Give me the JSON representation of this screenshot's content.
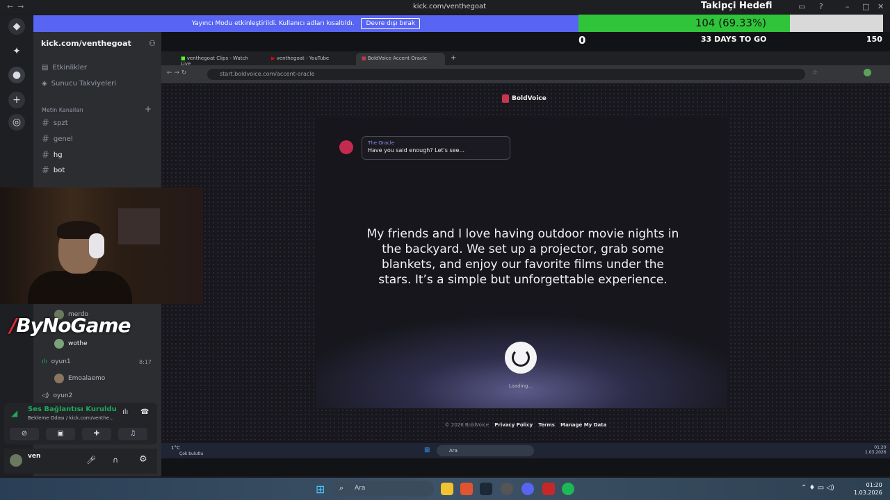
{
  "titlebar": {
    "url": "kick.com/venthegoat"
  },
  "banner": {
    "message": "Yayıncı Modu etkinleştirildi. Kullanıcı adları kısaltıldı.",
    "button": "Devre dışı bırak"
  },
  "goal": {
    "title": "Takipçi Hedefi",
    "progress_text": "104 (69.33%)",
    "progress": 0.6933,
    "min": "0",
    "days_left": "33 DAYS TO GO",
    "max": "150",
    "fill_color": "#2fc43a"
  },
  "sidebar": {
    "server_name": "kick.com/venthegoat",
    "items": [
      "Etkinlikler",
      "Sunucu Takviyeleri"
    ],
    "category": "Metin Kanalları",
    "channels": [
      "spzt",
      "genel",
      "hg",
      "bot"
    ]
  },
  "voice": {
    "users": [
      "merdo",
      "wothe"
    ],
    "channel1": "oyun1",
    "channel1_time": "8:17",
    "channel1_user": "Emoalaemo",
    "channel2": "oyun2",
    "status": "Ses Bağlantısı Kuruldu",
    "status_sub": "Bekleme Odası / kick.com/venthe...",
    "username": "ven"
  },
  "overlay": {
    "brand": "ByNoGame"
  },
  "browser": {
    "tabs": [
      "venthegoat Clips - Watch Live",
      "venthegoat - YouTube",
      "BoldVoice Accent Oracle"
    ],
    "url": "start.boldvoice.com/accent-oracle"
  },
  "boldvoice": {
    "logo": "BoldVoice",
    "oracle_name": "The Oracle",
    "oracle_message": "Have you said enough? Let's see...",
    "sentence": "My friends and I love having outdoor movie nights in the backyard. We set up a projector, grab some blankets, and enjoy our favorite films under the stars. It’s a simple but unforgettable experience.",
    "loading": "Loading...",
    "footer_copy": "© 2026 BoldVoice",
    "footer_links": [
      "Privacy Policy",
      "Terms",
      "Manage My Data"
    ]
  },
  "inner_taskbar": {
    "weather_temp": "1°C",
    "weather_desc": "Çok bulutlu",
    "search": "Ara",
    "time": "01:20",
    "date": "1.03.2026"
  },
  "taskbar": {
    "search": "Ara",
    "time": "01:20",
    "date": "1.03.2026"
  }
}
